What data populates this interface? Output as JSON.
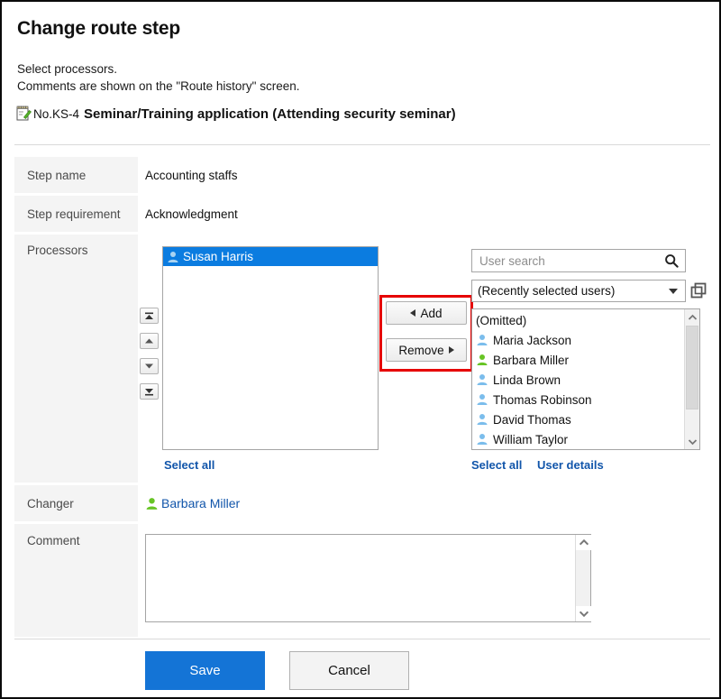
{
  "header": {
    "title": "Change route step",
    "instruction_line_1": "Select processors.",
    "instruction_line_2": "Comments are shown on the \"Route history\" screen.",
    "application_icon": "memo-document-icon",
    "application_number": "No.KS-4",
    "application_name": "Seminar/Training application (Attending security seminar)"
  },
  "form": {
    "step_name": {
      "label": "Step name",
      "value": "Accounting staffs"
    },
    "step_requirement": {
      "label": "Step requirement",
      "value": "Acknowledgment"
    },
    "processors": {
      "label": "Processors"
    },
    "changer": {
      "label": "Changer",
      "value": "Barbara Miller",
      "icon": "user-green-icon"
    },
    "comment": {
      "label": "Comment",
      "value": ""
    }
  },
  "processors": {
    "order_buttons": [
      {
        "name": "move-to-top",
        "glyph": "⤒"
      },
      {
        "name": "move-up",
        "glyph": "▲"
      },
      {
        "name": "move-down",
        "glyph": "▼"
      },
      {
        "name": "move-to-bottom",
        "glyph": "⤓"
      }
    ],
    "selected_users": [
      {
        "name": "Susan Harris",
        "icon": "user-blue-icon",
        "selected": true
      }
    ],
    "select_all_label": "Select all",
    "transfer_buttons": {
      "add_label": "Add",
      "remove_label": "Remove",
      "highlight_color": "#e60000"
    }
  },
  "user_picker": {
    "search": {
      "placeholder": "User search",
      "value": "",
      "icon": "search-icon"
    },
    "source_select": {
      "value": "(Recently selected users)",
      "options": [
        "(Recently selected users)"
      ],
      "caret_icon": "chevron-down-icon"
    },
    "expand_icon": "copy-windows-icon",
    "list_header": "(Omitted)",
    "candidates": [
      {
        "name": "Maria Jackson",
        "icon": "user-blue-icon"
      },
      {
        "name": "Barbara Miller",
        "icon": "user-green-icon"
      },
      {
        "name": "Linda Brown",
        "icon": "user-blue-icon"
      },
      {
        "name": "Thomas Robinson",
        "icon": "user-blue-icon"
      },
      {
        "name": "David Thomas",
        "icon": "user-blue-icon"
      },
      {
        "name": "William Taylor",
        "icon": "user-blue-icon"
      }
    ],
    "select_all_label": "Select all",
    "user_details_label": "User details"
  },
  "footer": {
    "save_label": "Save",
    "cancel_label": "Cancel",
    "save_color": "#1474d6"
  }
}
